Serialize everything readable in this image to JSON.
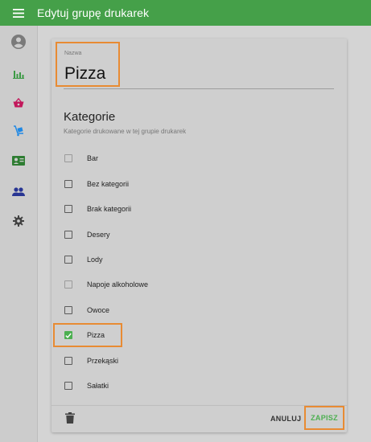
{
  "topbar": {
    "title": "Edytuj grupę drukarek",
    "menu_icon": "hamburger-menu-icon",
    "color": "#45a049"
  },
  "sidebar": {
    "items": [
      {
        "name": "account",
        "icon": "account-circle-icon",
        "color": "#7a7a7a"
      },
      {
        "name": "reports",
        "icon": "bar-chart-icon",
        "color": "#3c9a45"
      },
      {
        "name": "orders",
        "icon": "basket-icon",
        "color": "#c2185b"
      },
      {
        "name": "delivery",
        "icon": "delivery-icon",
        "color": "#1e88e5"
      },
      {
        "name": "contacts",
        "icon": "contact-card-icon",
        "color": "#2e7d32"
      },
      {
        "name": "staff",
        "icon": "people-icon",
        "color": "#283593"
      },
      {
        "name": "settings",
        "icon": "gear-icon",
        "color": "#424242"
      }
    ]
  },
  "form": {
    "name_label": "Nazwa",
    "name_value": "Pizza",
    "section_title": "Kategorie",
    "section_subtitle": "Kategorie drukowane w tej grupie drukarek",
    "categories": [
      {
        "label": "Bar",
        "checked": false,
        "disabled_look": true
      },
      {
        "label": "Bez kategorii",
        "checked": false
      },
      {
        "label": "Brak kategorii",
        "checked": false
      },
      {
        "label": "Desery",
        "checked": false
      },
      {
        "label": "Lody",
        "checked": false
      },
      {
        "label": "Napoje alkoholowe",
        "checked": false,
        "disabled_look": true
      },
      {
        "label": "Owoce",
        "checked": false
      },
      {
        "label": "Pizza",
        "checked": true
      },
      {
        "label": "Przekąski",
        "checked": false
      },
      {
        "label": "Sałatki",
        "checked": false
      }
    ],
    "cancel_label": "ANULUJ",
    "save_label": "ZAPISZ",
    "delete_icon": "trash-icon",
    "accent": "#4caf50",
    "highlight": "#e88b33"
  }
}
